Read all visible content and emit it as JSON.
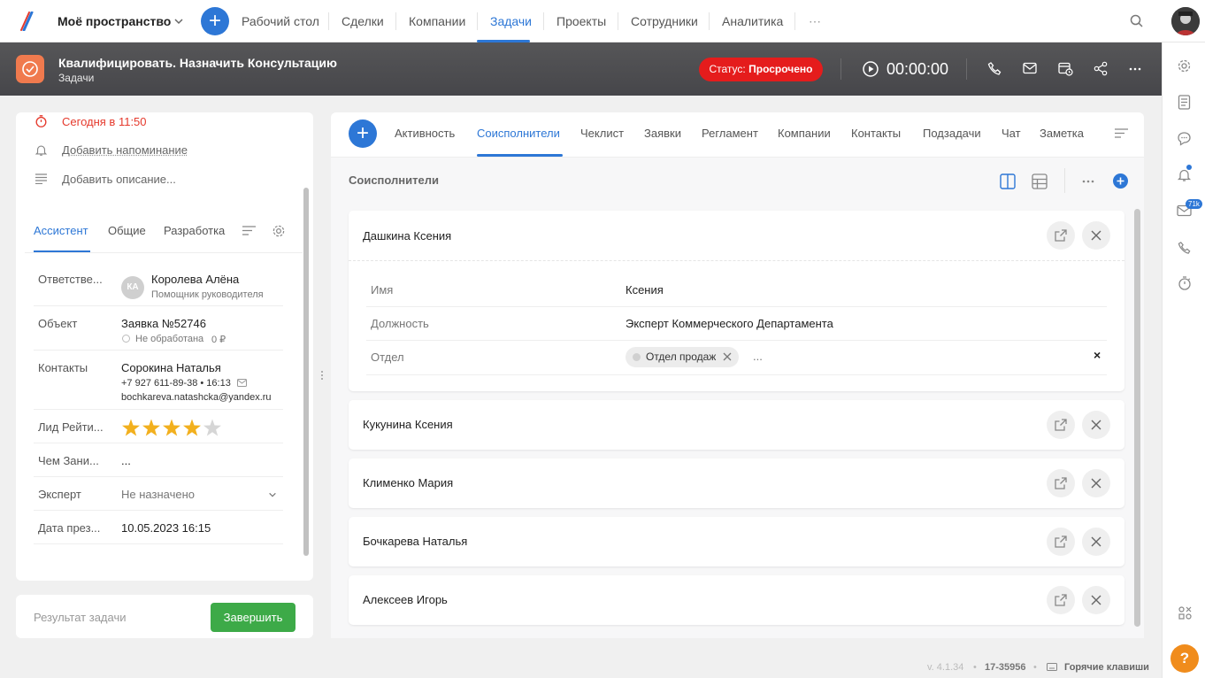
{
  "topnav": {
    "workspace": "Моё пространство",
    "items": [
      "Рабочий стол",
      "Сделки",
      "Компании",
      "Задачи",
      "Проекты",
      "Сотрудники",
      "Аналитика"
    ],
    "more": "⋯",
    "active_index": 3,
    "accent": "#2d77d6"
  },
  "header": {
    "title": "Квалифицировать. Назначить Консультацию",
    "subtitle": "Задачи",
    "status_prefix": "Статус:",
    "status_value": "Просрочено",
    "status_color": "#e51c1c",
    "timer": "00:00:00"
  },
  "rail": {
    "mail_badge": "71k",
    "help": "?"
  },
  "left": {
    "due": "Сегодня в 11:50",
    "add_reminder": "Добавить напоминание",
    "add_description": "Добавить описание...",
    "tabs": [
      "Ассистент",
      "Общие",
      "Разработка"
    ],
    "active_tab": 0,
    "fields": {
      "responsible_label": "Ответстве...",
      "responsible_avatar": "КА",
      "responsible_name": "Королева Алёна",
      "responsible_role": "Помощник руководителя",
      "object_label": "Объект",
      "object_value": "Заявка №52746",
      "object_status": "Не обработана",
      "object_sum": "0 ₽",
      "contacts_label": "Контакты",
      "contact_name": "Сорокина Наталья",
      "contact_phone": "+7 927 611-89-38 • 16:13",
      "contact_email": "bochkareva.natashcka@yandex.ru",
      "rating_label": "Лид Рейти...",
      "rating": 4,
      "rating_max": 5,
      "occupation_label": "Чем Зани...",
      "occupation_value": "...",
      "expert_label": "Эксперт",
      "expert_value": "Не назначено",
      "presentation_label": "Дата през...",
      "presentation_value": "10.05.2023 16:15"
    },
    "result_placeholder": "Результат задачи",
    "finish_label": "Завершить",
    "finish_color": "#3daa48"
  },
  "main": {
    "tabs": [
      "Активность",
      "Соисполнители",
      "Чеклист",
      "Заявки",
      "Регламент",
      "Компании",
      "Контакты",
      "Подзадачи",
      "Чат",
      "Заметка"
    ],
    "active_tab": 1,
    "section_title": "Соисполнители",
    "more": "⋯",
    "coexecutors": [
      {
        "name": "Дашкина Ксения"
      },
      {
        "name": "Кукунина Ксения"
      },
      {
        "name": "Клименко Мария"
      },
      {
        "name": "Бочкарева Наталья"
      },
      {
        "name": "Алексеев Игорь"
      }
    ],
    "details": {
      "name_label": "Имя",
      "name_value": "Ксения",
      "position_label": "Должность",
      "position_value": "Эксперт Коммерческого Департамента",
      "dept_label": "Отдел",
      "dept_chip": "Отдел продаж",
      "dept_more": "...",
      "dept_clear": "×"
    }
  },
  "footer": {
    "version": "v. 4.1.34",
    "build": "17-35956",
    "hotkeys": "Горячие клавиши"
  }
}
